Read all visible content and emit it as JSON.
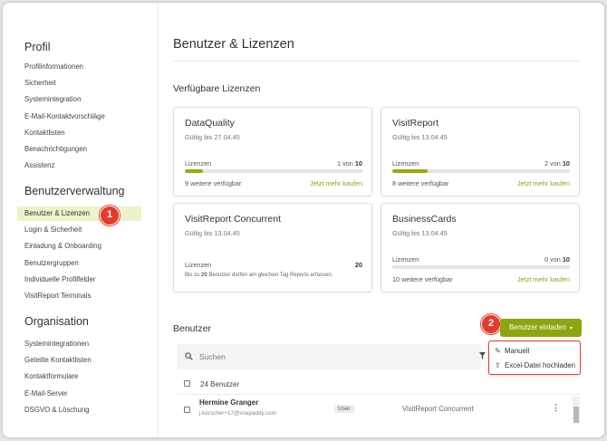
{
  "sidebar": {
    "sections": [
      {
        "title": "Profil",
        "items": [
          "Profilinformationen",
          "Sicherheit",
          "Systemintegration",
          "E-Mail-Kontaktvorschläge",
          "Kontaktlisten",
          "Benachrichtigungen",
          "Assistenz"
        ]
      },
      {
        "title": "Benutzerverwaltung",
        "items": [
          "Benutzer & Lizenzen",
          "Login & Sicherheit",
          "Einladung & Onboarding",
          "Benutzergruppen",
          "Individuelle Profilfelder",
          "VisitReport Terminals"
        ]
      },
      {
        "title": "Organisation",
        "items": [
          "Systemintegrationen",
          "Geteilte Kontaktlisten",
          "Kontaktformulare",
          "E-Mail-Server",
          "DSGVO & Löschung"
        ]
      }
    ],
    "active_item": "Benutzer & Lizenzen"
  },
  "annotations": {
    "step1": "1",
    "step2": "2"
  },
  "main": {
    "page_title": "Benutzer & Lizenzen",
    "licenses_heading": "Verfügbare Lizenzen",
    "licenses": [
      {
        "name": "DataQuality",
        "valid": "Gültig bis 27.04.45",
        "label": "Lizenzen",
        "used": "1",
        "of": "von",
        "total": "10",
        "fill": 0.1,
        "available": "9 weitere verfügbar",
        "buy": "Jetzt mehr kaufen"
      },
      {
        "name": "VisitReport",
        "valid": "Gültig bis 13.04.45",
        "label": "Lizenzen",
        "used": "2",
        "of": "von",
        "total": "10",
        "fill": 0.2,
        "available": "8 weitere verfügbar",
        "buy": "Jetzt mehr kaufen"
      },
      {
        "name": "VisitReport Concurrent",
        "valid": "Gültig bis 13.04.45",
        "label": "Lizenzen",
        "count": "20",
        "note_pre": "Bis zu",
        "note_num": "20",
        "note_post": "Benutzer dürfen am gleichen Tag Reports erfassen."
      },
      {
        "name": "BusinessCards",
        "valid": "Gültig bis 13.04.45",
        "label": "Lizenzen",
        "used": "0",
        "of": "von",
        "total": "10",
        "fill": 0.0,
        "available": "10 weitere verfügbar",
        "buy": "Jetzt mehr kaufen"
      }
    ],
    "users_heading": "Benutzer",
    "invite_button": "Benutzer einladen",
    "invite_menu": [
      "Manuell",
      "Excel-Datei hochladen"
    ],
    "search_placeholder": "Suchen",
    "user_count": "24 Benutzer",
    "users": [
      {
        "name": "Hermine Granger",
        "email": "j.kerscher+17@snapaddy.com",
        "role": "User",
        "license": "VisitReport Concurrent"
      }
    ]
  },
  "colors": {
    "accent": "#8ea50f",
    "active_bg": "#edf2c9",
    "annotation": "#e23a2e"
  },
  "icons": [
    "search-icon",
    "filter-icon",
    "pencil-icon",
    "upload-icon",
    "more-vert-icon",
    "chevron-down-icon"
  ]
}
